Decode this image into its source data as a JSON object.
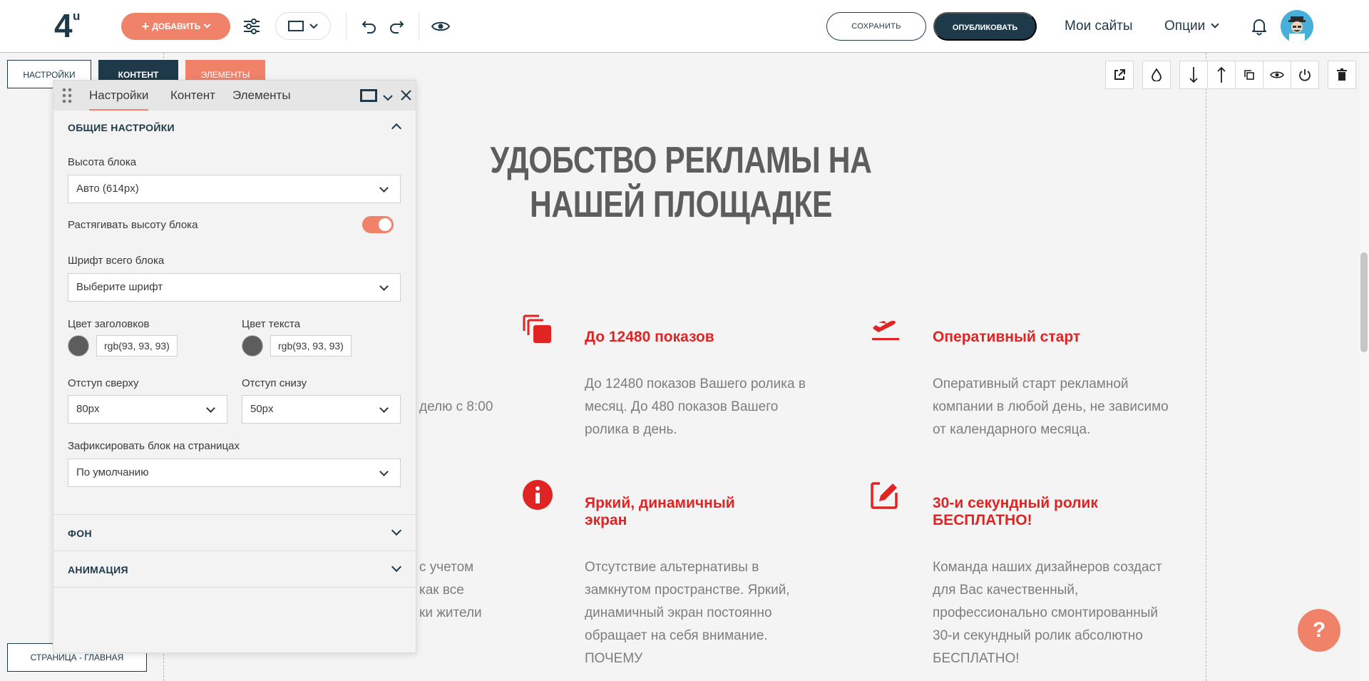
{
  "topbar": {
    "logo_main": "4",
    "logo_sup": "u",
    "add_label": "ДОБАВИТЬ",
    "save_label": "СОХРАНИТЬ",
    "publish_label": "ОПУБЛИКОВАТЬ",
    "my_sites": "Мои сайты",
    "options": "Опции"
  },
  "mode_tabs": {
    "settings": "НАСТРОЙКИ",
    "content": "КОНТЕНТ",
    "elements": "ЭЛЕМЕНТЫ"
  },
  "page_label": "СТРАНИЦА - ГЛАВНАЯ",
  "help": "?",
  "panel": {
    "tabs": [
      "Настройки",
      "Контент",
      "Элементы"
    ],
    "general_title": "ОБЩИЕ НАСТРОЙКИ",
    "block_height_label": "Высота блока",
    "block_height_value": "Авто (614px)",
    "stretch_label": "Растягивать высоту блока",
    "stretch_on": true,
    "font_label": "Шрифт всего блока",
    "font_placeholder": "Выберите шрифт",
    "heading_color_label": "Цвет заголовков",
    "heading_color_value": "rgb(93, 93, 93)",
    "text_color_label": "Цвет текста",
    "text_color_value": "rgb(93, 93, 93)",
    "padding_top_label": "Отступ сверху",
    "padding_top_value": "80px",
    "padding_bottom_label": "Отступ снизу",
    "padding_bottom_value": "50px",
    "fix_label": "Зафиксировать блок на страницах",
    "fix_value": "По умолчанию",
    "bg_title": "ФОН",
    "anim_title": "АНИМАЦИЯ"
  },
  "content": {
    "headline": "УДОБСТВО РЕКЛАМЫ НА НАШЕЙ ПЛОЩАДКЕ",
    "partial_1": "делю с 8:00",
    "partial_2": [
      "с учетом",
      "как все",
      "ки жители"
    ],
    "features": [
      {
        "icon": "copy-stack-icon",
        "title": "До 12480 показов",
        "text": [
          "До 12480 показов Вашего ролика в",
          "месяц. До 480 показов Вашего",
          "ролика в день."
        ]
      },
      {
        "icon": "plane-takeoff-icon",
        "title": "Оперативный старт",
        "text": [
          "Оперативный старт рекламной",
          "компании в любой день, не зависимо",
          "от календарного месяца."
        ]
      },
      {
        "icon": "info-icon",
        "title": [
          "Яркий, динамичный",
          "экран"
        ],
        "text": [
          "Отсутствие альтернативы в",
          "замкнутом пространстве. Яркий,",
          "динамичный экран постоянно",
          "обращает на себя внимание.",
          "ПОЧЕМУ"
        ]
      },
      {
        "icon": "edit-icon",
        "title": [
          "30-и секундный ролик",
          "БЕСПЛАТНО!"
        ],
        "text": [
          "Команда наших дизайнеров создаст",
          "для Вас качественный,",
          "профессионально смонтированный",
          "30-и секундный ролик абсолютно",
          "БЕСПЛАТНО!"
        ]
      }
    ]
  },
  "colors": {
    "accent": "#f0826a",
    "dark": "#1e3a4a",
    "feature_red": "#e02424",
    "text_gray": "#5d5d5d"
  }
}
